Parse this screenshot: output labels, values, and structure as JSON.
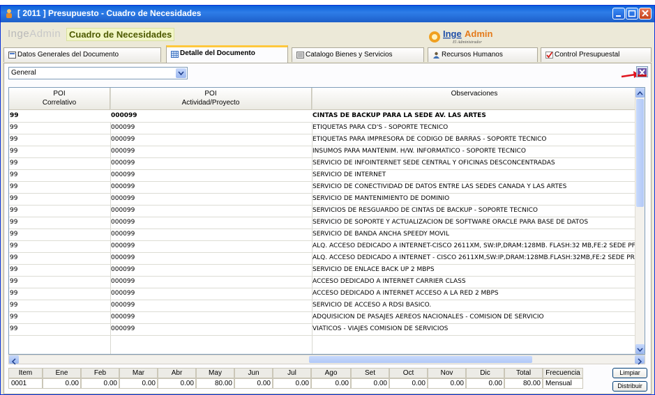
{
  "window": {
    "title": "[ 2011 ] Presupuesto - Cuadro de Necesidades"
  },
  "header": {
    "brand_inge": "Inge",
    "brand_admin": "Admin",
    "heading": "Cuadro de Necesidades",
    "logo_inge": "Inge",
    "logo_admin": "Admin",
    "logo_sub": "El Administrador"
  },
  "tabs": [
    {
      "label": "Datos Generales del Documento",
      "icon": "document-icon"
    },
    {
      "label": "Detalle del Documento",
      "icon": "grid-icon",
      "active": true
    },
    {
      "label": "Catalogo Bienes y Servicios",
      "icon": "catalog-icon"
    },
    {
      "label": "Recursos Humanos",
      "icon": "people-icon"
    },
    {
      "label": "Control Presupuestal",
      "icon": "check-icon"
    }
  ],
  "filter": {
    "selected": "General"
  },
  "grid": {
    "headers": [
      {
        "l1": "POI",
        "l2": "Correlativo"
      },
      {
        "l1": "POI",
        "l2": "Actividad/Proyecto"
      },
      {
        "l1": "Observaciones",
        "l2": ""
      }
    ],
    "rows": [
      {
        "c1": "99",
        "c2": "000099",
        "c3": "CINTAS DE BACKUP PARA LA SEDE AV. LAS ARTES"
      },
      {
        "c1": "99",
        "c2": "000099",
        "c3": "ETIQUETAS PARA CD'S - SOPORTE TECNICO"
      },
      {
        "c1": "99",
        "c2": "000099",
        "c3": "ETIQUETAS PARA IMPRESORA DE CÓDIGO DE BARRAS - SOPORTE TECNICO"
      },
      {
        "c1": "99",
        "c2": "000099",
        "c3": "INSUMOS PARA MANTENIM. H/W. INFORMÁTICO - SOPORTE TECNICO"
      },
      {
        "c1": "99",
        "c2": "000099",
        "c3": "SERVICIO DE INFOINTERNET SEDE CENTRAL Y OFICINAS DESCONCENTRADAS"
      },
      {
        "c1": "99",
        "c2": "000099",
        "c3": "SERVICIO DE INTERNET"
      },
      {
        "c1": "99",
        "c2": "000099",
        "c3": "SERVICIO DE CONECTIVIDAD DE DATOS ENTRE LAS SEDES CANADA Y LAS ARTES"
      },
      {
        "c1": "99",
        "c2": "000099",
        "c3": "SERVICIO DE MANTENIMIENTO DE DOMINIO"
      },
      {
        "c1": "99",
        "c2": "000099",
        "c3": "SERVICIOS DE RESGUARDO DE CINTAS DE BACKUP - SOPORTE TECNICO"
      },
      {
        "c1": "99",
        "c2": "000099",
        "c3": "SERVICIO DE SOPORTE Y ACTUALIZACION DE SOFTWARE ORACLE PARA BASE DE DATOS"
      },
      {
        "c1": "99",
        "c2": "000099",
        "c3": "SERVICIO DE BANDA ANCHA SPEEDY MÓVIL"
      },
      {
        "c1": "99",
        "c2": "000099",
        "c3": "ALQ. ACCESO DEDICADO A INTERNET-CISCO 2611XM, SW:IP,DRAM:128MB. FLASH:32 MB,FE:2 SEDE PF"
      },
      {
        "c1": "99",
        "c2": "000099",
        "c3": "ALQ. ACCESO DEDICADO A INTERNET - CISCO 2611XM,SW:IP,DRAM:128MB.FLASH:32MB,FE:2 SEDE PR"
      },
      {
        "c1": "99",
        "c2": "000099",
        "c3": "SERVICIO DE ENLACE BACK UP 2 MBPS"
      },
      {
        "c1": "99",
        "c2": "000099",
        "c3": "ACCESO DEDICADO A INTERNET CARRIER CLASS"
      },
      {
        "c1": "99",
        "c2": "000099",
        "c3": "ACCESO DEDICADO A INTERNET ACCESO A LA RED 2 MBPS"
      },
      {
        "c1": "99",
        "c2": "000099",
        "c3": "SERVICIO DE ACCESO A RDSI BÁSICO."
      },
      {
        "c1": "99",
        "c2": "000099",
        "c3": "ADQUISICIÓN DE PASAJES AÉREOS NACIONALES - COMISION DE SERVICIO"
      },
      {
        "c1": "99",
        "c2": "000099",
        "c3": "VIATICOS - VIAJES COMISION DE SERVICIOS"
      }
    ]
  },
  "monthly": {
    "headers": [
      "Item",
      "Ene",
      "Feb",
      "Mar",
      "Abr",
      "May",
      "Jun",
      "Jul",
      "Ago",
      "Set",
      "Oct",
      "Nov",
      "Dic",
      "Total",
      "Frecuencia"
    ],
    "values": [
      "0001",
      "0.00",
      "0.00",
      "0.00",
      "0.00",
      "80.00",
      "0.00",
      "0.00",
      "0.00",
      "0.00",
      "0.00",
      "0.00",
      "0.00",
      "80.00",
      "Mensual"
    ]
  },
  "buttons": {
    "limpiar": "Limpiar",
    "distribuir": "Distribuir"
  },
  "colors": {
    "title_bar": "#0a5fd8",
    "active_tab_accent": "#ffc83c",
    "annotation_arrow": "#e0141e",
    "heading_text": "#4d5a00"
  }
}
